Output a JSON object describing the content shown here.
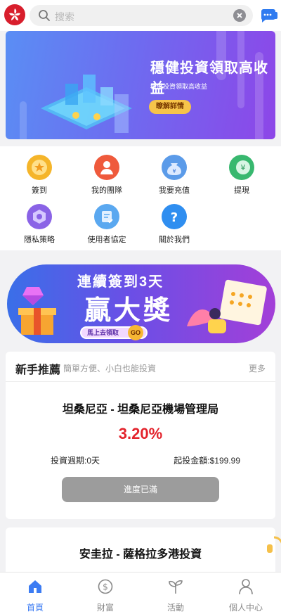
{
  "header": {
    "logo_icon": "hong-kong-emblem",
    "search_placeholder": "搜索",
    "clear_icon": "clear-circle-icon",
    "chat_icon": "chat-bubble-icon"
  },
  "banner": {
    "title": "穩健投資領取高收益",
    "subtitle": "穩健投資領取高收益",
    "button": "瞭解詳情"
  },
  "quick_actions": [
    {
      "label": "簽到",
      "icon": "checkin-star-icon",
      "color": "#f5b52a"
    },
    {
      "label": "我的團隊",
      "icon": "team-user-icon",
      "color": "#ef5a3c"
    },
    {
      "label": "我要充值",
      "icon": "recharge-bag-icon",
      "color": "#5b9be9"
    },
    {
      "label": "提現",
      "icon": "withdraw-yen-icon",
      "color": "#38b86f"
    },
    {
      "label": "隱私策略",
      "icon": "privacy-hexagon-icon",
      "color": "#8a63e6"
    },
    {
      "label": "使用者協定",
      "icon": "agreement-doc-icon",
      "color": "#5aa8f0"
    },
    {
      "label": "關於我們",
      "icon": "question-icon",
      "color": "#2f8ef0"
    }
  ],
  "promo": {
    "line1": "連續簽到3天",
    "line2": "贏大獎",
    "button": "馬上去領取",
    "go": "GO"
  },
  "recommend": {
    "title": "新手推薦",
    "subtitle": "簡單方便、小白也能投資",
    "more": "更多",
    "product": {
      "name": "坦桑尼亞 - 坦桑尼亞機場管理局",
      "rate": "3.20%",
      "period": "投資週期:0天",
      "min_amount": "起投金額:$199.99",
      "status_button": "進度已滿"
    }
  },
  "next_product": {
    "name": "安圭拉 - 薩格拉多港投資"
  },
  "tabbar": {
    "items": [
      {
        "label": "首頁",
        "icon": "home-icon",
        "active": true
      },
      {
        "label": "財富",
        "icon": "dollar-circle-icon",
        "active": false
      },
      {
        "label": "活動",
        "icon": "sprout-icon",
        "active": false
      },
      {
        "label": "個人中心",
        "icon": "user-icon",
        "active": false
      }
    ],
    "active_color": "#3c7cf3"
  }
}
